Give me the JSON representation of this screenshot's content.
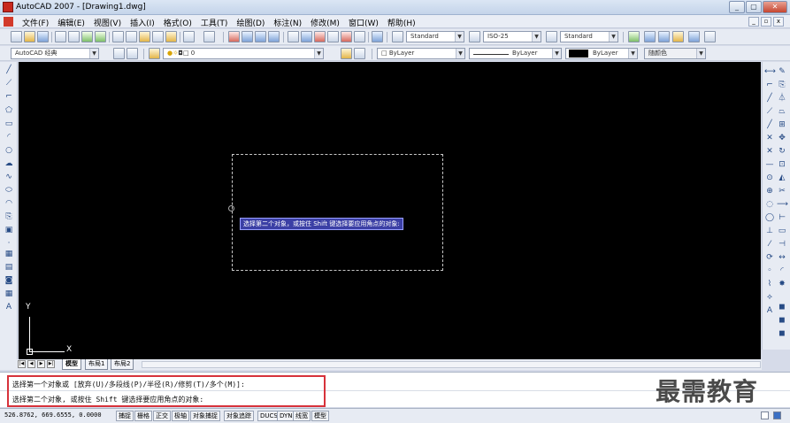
{
  "window": {
    "title": "AutoCAD 2007 - [Drawing1.dwg]"
  },
  "menu": [
    "文件(F)",
    "编辑(E)",
    "视图(V)",
    "插入(I)",
    "格式(O)",
    "工具(T)",
    "绘图(D)",
    "标注(N)",
    "修改(M)",
    "窗口(W)",
    "帮助(H)"
  ],
  "toolbar1": {
    "text_style": "Standard",
    "dim_style": "ISO-25",
    "table_style": "Standard"
  },
  "toolbar2": {
    "workspace": "AutoCAD 经典",
    "layer": "0",
    "color": "ByLayer",
    "linetype": "ByLayer",
    "lineweight": "ByLayer",
    "plotstyle": "随颜色"
  },
  "canvas": {
    "tooltip": "选择第二个对象，或按住 Shift 键选择要应用角点的对象:",
    "ucs_x": "X",
    "ucs_y": "Y",
    "background": "#000000"
  },
  "tabs": [
    "模型",
    "布局1",
    "布局2"
  ],
  "command": {
    "line1": "选择第一个对象或 [放弃(U)/多段线(P)/半径(R)/修剪(T)/多个(M)]:",
    "line2": "选择第二个对象, 或按住 Shift 键选择要应用角点的对象:"
  },
  "watermark": "最需教育",
  "status": {
    "coords": "526.8762, 669.6555, 0.0000",
    "buttons": [
      "捕捉",
      "栅格",
      "正交",
      "极轴",
      "对象捕捉",
      "对象追踪",
      "DUCS",
      "DYN",
      "线宽",
      "模型"
    ]
  },
  "colors": {
    "highlight_box": "#d7323b",
    "tooltip_bg": "#3b3fa5"
  }
}
